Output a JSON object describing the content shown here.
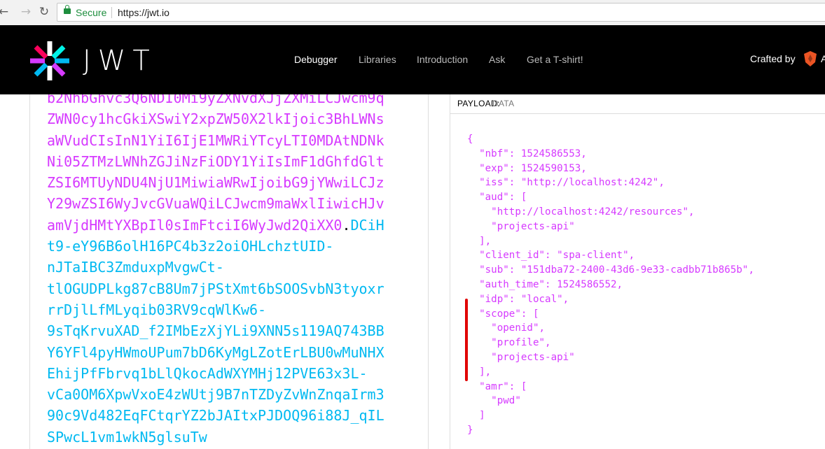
{
  "browser": {
    "back_icon": "back-arrow-icon",
    "forward_icon": "forward-arrow-icon",
    "reload_icon": "reload-icon",
    "secure_label": "Secure",
    "url": "https://jwt.io"
  },
  "header": {
    "logo_text": "JWT",
    "nav": [
      "Debugger",
      "Libraries",
      "Introduction",
      "Ask",
      "Get a T-shirt!"
    ],
    "active_nav": "Debugger",
    "crafted_by": "Crafted by",
    "auth0_initial": "A"
  },
  "encoded": {
    "payload_lines": [
      "b2NhbGhvc3Q6NDI0Mi9yZXNvdXJjZXMiLCJwcm9q",
      "ZWN0cy1hcGkiXSwiY2xpZW50X2lkIjoic3BhLWNs",
      "aWVudCIsInN1YiI6IjE1MWRiYTcyLTI0MDAtNDNk",
      "Ni05ZTMzLWNhZGJiNzFiODY1YiIsImF1dGhfdGlt",
      "ZSI6MTUyNDU4NjU1MiwiaWRwIjoibG9jYWwiLCJz",
      "Y29wZSI6WyJvcGVuaWQiLCJwcm9maWxlIiwicHJv"
    ],
    "payload_tail": "amVjdHMtYXBpIl0sImFtciI6WyJwd2QiXX0",
    "dot": ".",
    "signature_head": "DCiH",
    "signature_lines": [
      "t9-eY96B6olH16PC4b3z2oiOHLchztUID-",
      "nJTaIBC3ZmduxpMvgwCt-",
      "tlOGUDPLkg87cB8Um7jPStXmt6bSOOSvbN3tyoxr",
      "rrDjlLfMLyqib03RV9cqWlKw6-",
      "9sTqKrvuXAD_f2IMbEzXjYLi9XNN5s119AQ743BB",
      "Y6YFl4pyHWmoUPum7bD6KyMgLZotErLBU0wMuNHX",
      "EhijPfFbrvq1bLlQkocAdWXYMHj12PVE63x3L-",
      "vCa0OM6XpwVxoE4zWUtj9B7nTZDyZvWnZnqaIrm3",
      "90c9Vd482EqFCtqrYZ2bJAItxPJDOQ96i88J_qIL",
      "SPwcL1vm1wkN5glsuTw"
    ]
  },
  "payload": {
    "title": "PAYLOAD:",
    "subtitle": "DATA",
    "json_lines": [
      "{",
      "  \"nbf\": 1524586553,",
      "  \"exp\": 1524590153,",
      "  \"iss\": \"http://localhost:4242\",",
      "  \"aud\": [",
      "    \"http://localhost:4242/resources\",",
      "    \"projects-api\"",
      "  ],",
      "  \"client_id\": \"spa-client\",",
      "  \"sub\": \"151dba72-2400-43d6-9e33-cadbb71b865b\",",
      "  \"auth_time\": 1524586552,",
      "  \"idp\": \"local\",",
      "  \"scope\": [",
      "    \"openid\",",
      "    \"profile\",",
      "    \"projects-api\"",
      "  ],",
      "  \"amr\": [",
      "    \"pwd\"",
      "  ]",
      "}"
    ]
  },
  "colors": {
    "payload": "#d63aff",
    "signature": "#00b9f1",
    "annotation": "#e00000"
  }
}
